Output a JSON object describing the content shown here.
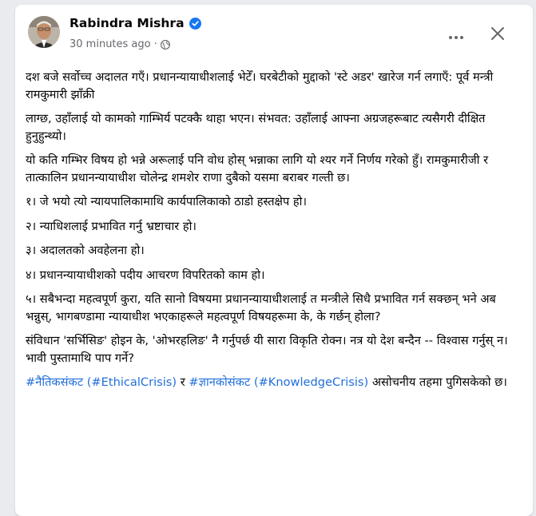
{
  "post": {
    "author": "Rabindra Mishra",
    "time": "30 minutes ago",
    "separator": "·",
    "paragraphs": [
      "दश बजे सर्वोच्च अदालत गएँ। प्रधानन्यायाधीशलाई भेटेँ। घरबेटीको मुद्दाको 'स्टे अडर' खारेज गर्न लगाएँ: पूर्व मन्त्री रामकुमारी झाँक्री",
      "लाग्छ, उहाँलाई यो कामको गाम्भिर्य पटक्कै थाहा भएन। संभवत: उहाँलाई आफ्ना अग्रजहरूबाट त्यसैगरी दीक्षित हुनुहुन्थ्यो।",
      "यो कति गम्भिर विषय हो भन्ने अरूलाई पनि वोध होस् भन्नाका लागि यो श्यर गर्ने निर्णय गरेको हुँ। रामकुमारीजी र तात्कालिन प्रधानन्यायाधीश चोलेन्द्र शमशेर राणा दुबैको यसमा बराबर गल्ती छ।",
      "१। जे भयो त्यो न्यायपालिकामाथि कार्यपालिकाको ठाडो हस्तक्षेप हो।",
      "२। न्याधिशलाई प्रभावित गर्नु भ्रष्टाचार हो।",
      "३। अदालतको अवहेलना हो।",
      "४। प्रधानन्यायाधीशको पदीय आचरण विपरितको काम हो।",
      "५। सबैभन्दा महत्वपूर्ण कुरा, यति सानो विषयमा प्रधानन्यायाधीशलाई त मन्त्रीले सिधै प्रभावित गर्न सक्छन् भने अब भन्नुस्, भागबण्डामा न्यायाधीश भएकाहरूले महत्वपूर्ण विषयहरूमा के, के गर्छन् होला?",
      "संविधान 'सर्भिसिङ' होइन के, 'ओभरहलिङ' नै गर्नुपर्छ यी सारा विकृति रोक्न। नत्र यो देश बन्दैन -- विश्वास गर्नुस् न। भावी पुस्तामाथि पाप गर्ने?"
    ],
    "last": {
      "tag1": "#नैतिकसंकट",
      "tag2": "(#EthicalCrisis)",
      "conj": " र ",
      "tag3": "#ज्ञानकोसंकट",
      "tag4": "(#KnowledgeCrisis)",
      "tail": " असोचनीय तहमा पुगिसकेको छ।"
    }
  },
  "colors": {
    "link": "#216fdb",
    "verified": "#1877f2",
    "muted": "#65676b"
  },
  "icons": [
    "verified-badge-icon",
    "globe-icon",
    "more-options-icon",
    "close-icon"
  ]
}
